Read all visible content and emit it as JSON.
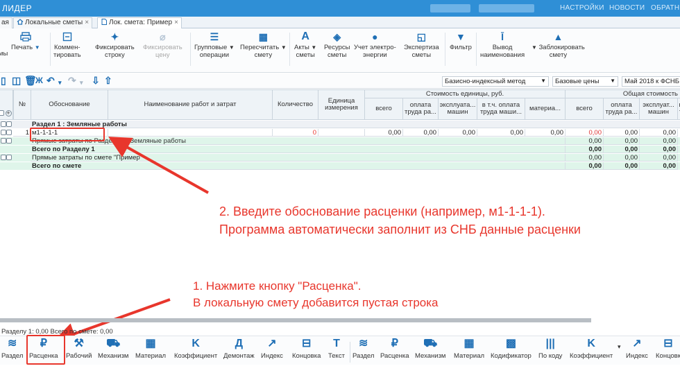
{
  "app": {
    "title": "ЛИДЕР",
    "menu": [
      "НАСТРОЙКИ",
      "НОВОСТИ",
      "ОБРАТН"
    ]
  },
  "tabs": [
    {
      "label": "ая",
      "close": ""
    },
    {
      "label": "Локальные сметы",
      "close": "×"
    },
    {
      "label": "Лок. смета: Пример",
      "close": "×"
    }
  ],
  "ribbon": {
    "items": [
      {
        "icon": "print-icon",
        "label1": "Печать",
        "label2": "",
        "dropdown": true
      },
      {
        "icon": "comment-icon",
        "label1": "Коммен-",
        "label2": "тировать"
      },
      {
        "icon": "pin-icon",
        "label1": "Фиксировать",
        "label2": "строку"
      },
      {
        "icon": "paperclip-icon",
        "label1": "Фиксировать",
        "label2": "цену",
        "disabled": true
      },
      {
        "icon": "list-icon",
        "label1": "Групповые",
        "label2": "операции",
        "dropdown": true
      },
      {
        "icon": "calculator-icon",
        "label1": "Пересчитать",
        "label2": "смету",
        "dropdown": true
      },
      {
        "icon": "letter-a-icon",
        "label1": "Акты",
        "label2": "сметы",
        "dropdown": true
      },
      {
        "icon": "cube-icon",
        "label1": "Ресурсы",
        "label2": "сметы"
      },
      {
        "icon": "electricity-icon",
        "label1": "Учет электро-",
        "label2": "энергии"
      },
      {
        "icon": "document-check-icon",
        "label1": "Экспертиза",
        "label2": "сметы"
      },
      {
        "icon": "filter-icon",
        "label1": "Фильтр",
        "label2": ""
      },
      {
        "icon": "text-cursor-icon",
        "label1": "Вывод",
        "label2": "наименования"
      },
      {
        "icon": "lock-icon",
        "label1": "Заблокировать",
        "label2": "смету",
        "dropdown": true
      }
    ],
    "left_cut": "мы"
  },
  "toolbar2": {
    "method": "Базисно-индексный метод",
    "prices": "Базовые цены",
    "index": "Май 2018 к ФСНБ"
  },
  "table": {
    "headers": {
      "num": "№",
      "basis": "Обоснование",
      "name": "Наименование работ и затрат",
      "qty": "Количество",
      "unit": "Единица измерения",
      "unit_cost_group": "Стоимость единицы, руб.",
      "total_cost_group": "Общая стоимость",
      "sub": [
        "всего",
        "оплата труда ра...",
        "эксплуата... машин",
        "в т.ч. оплата труда маши...",
        "материа...",
        "всего",
        "оплата труда ра...",
        "эксплуат... машин",
        "в т"
      ]
    },
    "rows": [
      {
        "type": "section",
        "text": "Раздел 1 : Земляные работы"
      },
      {
        "type": "item",
        "num": "1",
        "basis": "м1-1-1-1",
        "qty": "0",
        "u1": "0,00",
        "u2": "0,00",
        "u3": "0,00",
        "u4": "0,00",
        "u5": "0,00",
        "t1": "0,00",
        "t2": "0,00",
        "t3": "0,00"
      },
      {
        "type": "sub",
        "text": "Прямые затраты по Разделу 1 : Земляные работы",
        "t1": "0,00",
        "t2": "0,00",
        "t3": "0,00"
      },
      {
        "type": "total",
        "text": "Всего по Разделу 1",
        "t1": "0,00",
        "t2": "0,00",
        "t3": "0,00"
      },
      {
        "type": "sub",
        "text": "Прямые затраты по смете \"Пример\"",
        "t1": "0,00",
        "t2": "0,00",
        "t3": "0,00"
      },
      {
        "type": "total",
        "text": "Всего по смете",
        "t1": "0,00",
        "t2": "0,00",
        "t3": "0,00"
      }
    ]
  },
  "annotations": {
    "step2_line1": "2. Введите обоснование расценки (например, м1-1-1-1).",
    "step2_line2": "Программа автоматически заполнит из СНБ данные расценки",
    "step1_line1": "1. Нажмите кнопку \"Расценка\".",
    "step1_line2": "В локальную смету добавится пустая строка",
    "color": "#e8362c"
  },
  "status": "Разделу 1: 0,00   Всего по смете: 0,00",
  "bottom_left": [
    {
      "icon": "layers-icon",
      "label": "Раздел"
    },
    {
      "icon": "ruble-icon",
      "label": "Расценка"
    },
    {
      "icon": "worker-icon",
      "label": "Рабочий"
    },
    {
      "icon": "car-icon",
      "label": "Механизм"
    },
    {
      "icon": "bricks-icon",
      "label": "Материал"
    },
    {
      "icon": "letter-k-icon",
      "label": "Коэффициент"
    },
    {
      "icon": "letter-d-icon",
      "label": "Демонтаж"
    },
    {
      "icon": "chart-icon",
      "label": "Индекс"
    },
    {
      "icon": "end-icon",
      "label": "Концовка"
    },
    {
      "icon": "letter-t-icon",
      "label": "Текст"
    }
  ],
  "bottom_right": [
    {
      "icon": "layers-icon",
      "label": "Раздел"
    },
    {
      "icon": "ruble-icon",
      "label": "Расценка"
    },
    {
      "icon": "car-icon",
      "label": "Механизм"
    },
    {
      "icon": "bricks-icon",
      "label": "Материал"
    },
    {
      "icon": "codifier-icon",
      "label": "Кодификатор"
    },
    {
      "icon": "barcode-icon",
      "label": "По коду"
    },
    {
      "icon": "letter-k-icon",
      "label": "Коэффициент"
    },
    {
      "icon": "chart-icon",
      "label": "Индекс"
    },
    {
      "icon": "end-icon",
      "label": "Концовк"
    }
  ]
}
